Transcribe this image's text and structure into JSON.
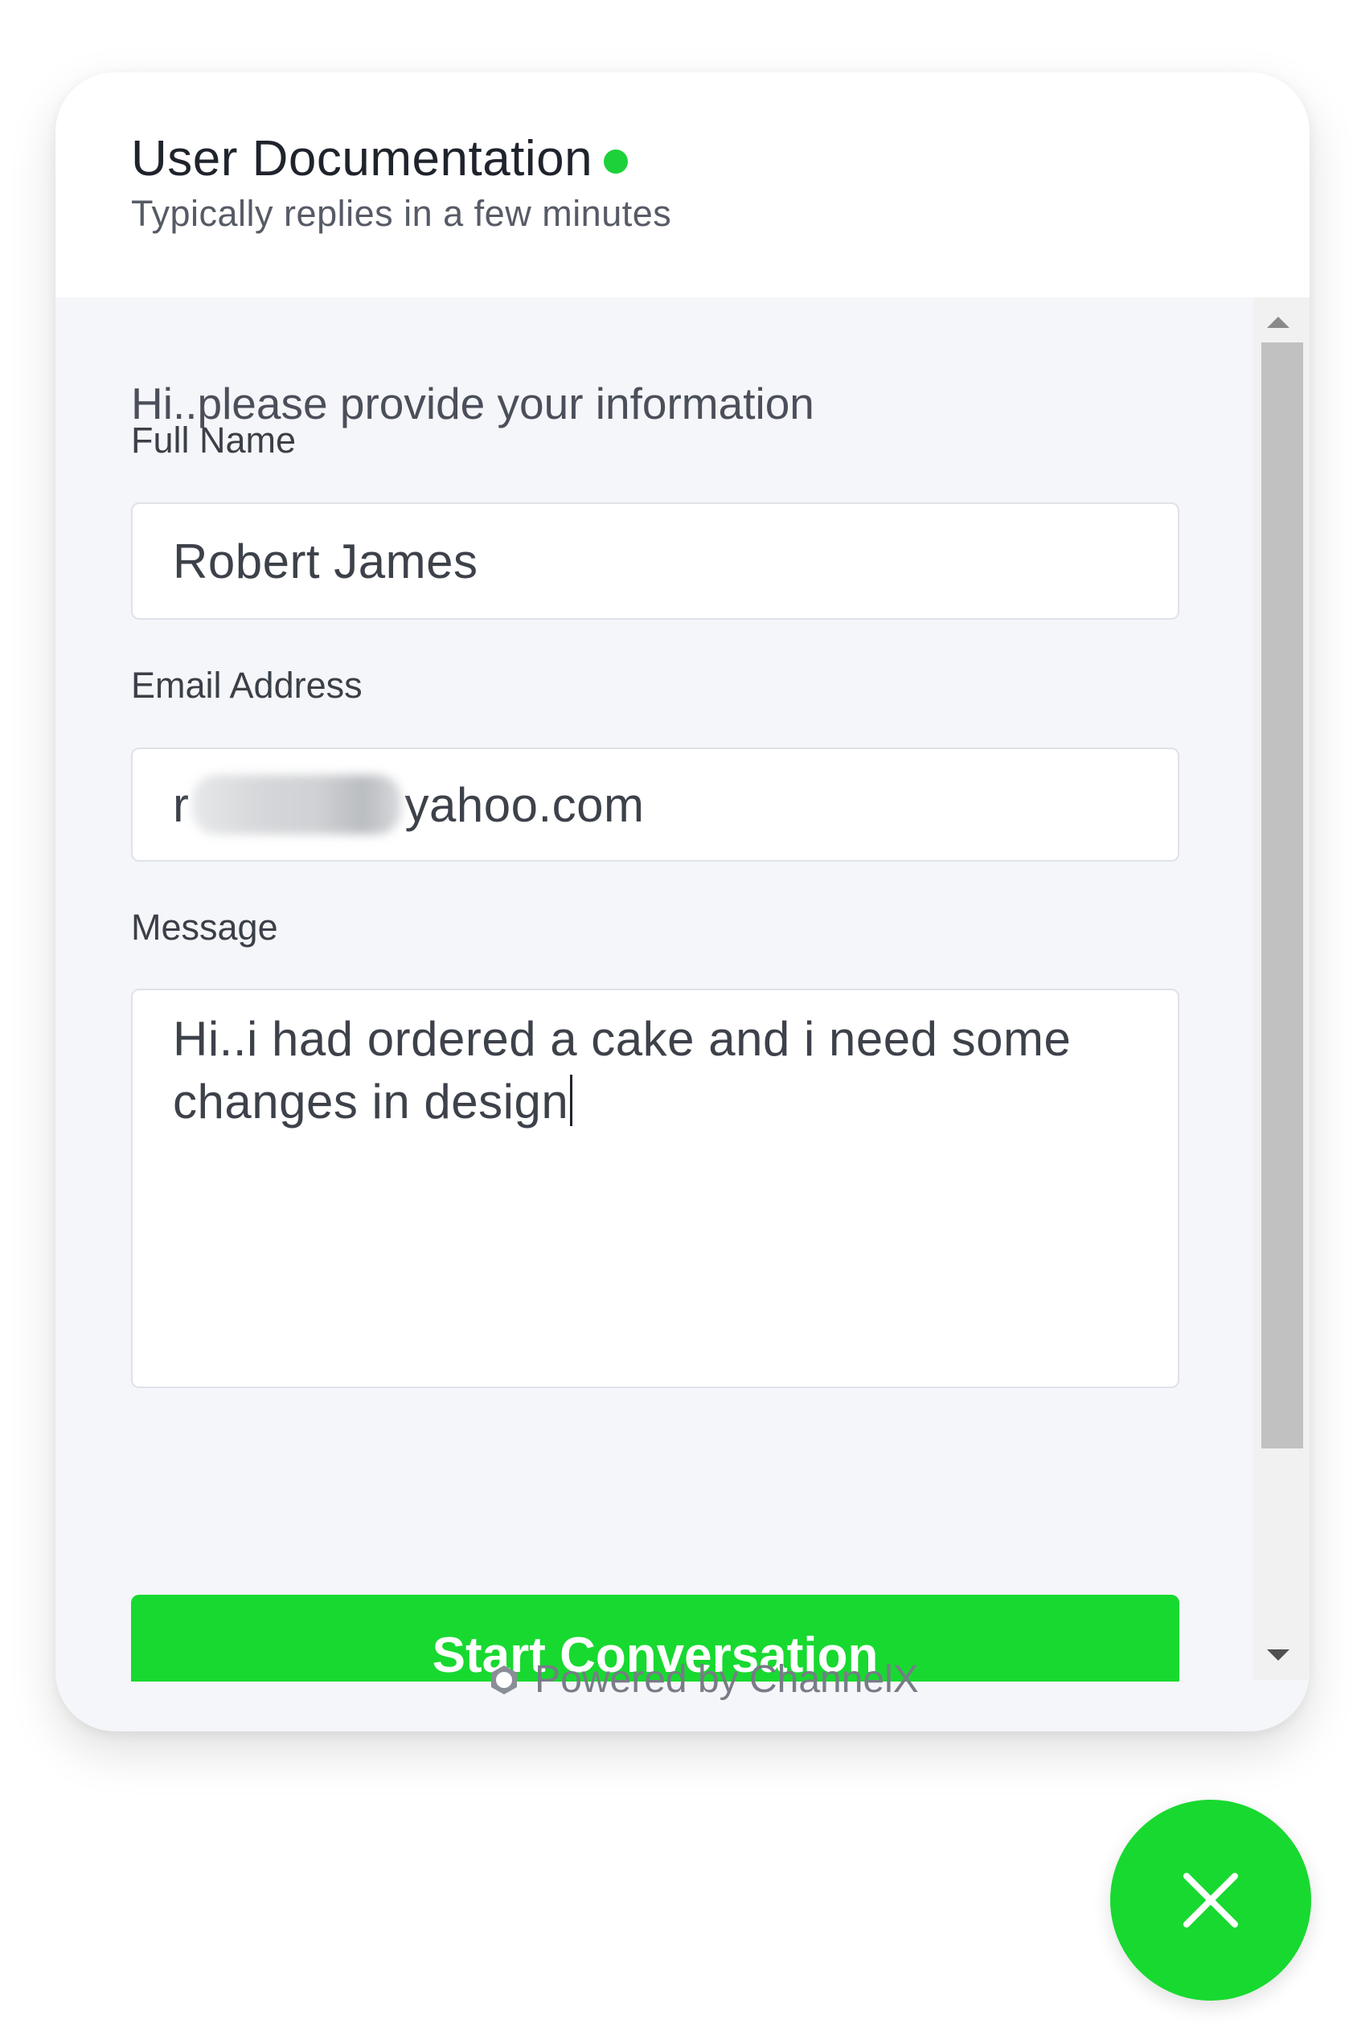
{
  "header": {
    "title": "User Documentation",
    "subtitle": "Typically replies in a few minutes",
    "status": "online"
  },
  "form": {
    "intro": "Hi..please provide your information",
    "full_name": {
      "label": "Full Name",
      "value": "Robert James"
    },
    "email": {
      "label": "Email Address",
      "value_prefix": "r",
      "value_suffix": "yahoo.com",
      "redacted": true
    },
    "message": {
      "label": "Message",
      "value": "Hi..i had ordered a cake and i need some changes in design"
    },
    "submit_label": "Start Conversation"
  },
  "footer": {
    "powered_by": "Powered by ChannelX",
    "logo_icon": "channelx-logo-icon"
  },
  "fab": {
    "icon": "close-icon"
  },
  "colors": {
    "accent": "#18d930",
    "online": "#1dd13a",
    "panel_bg": "#f5f6f9",
    "header_bg": "#ffffff"
  }
}
